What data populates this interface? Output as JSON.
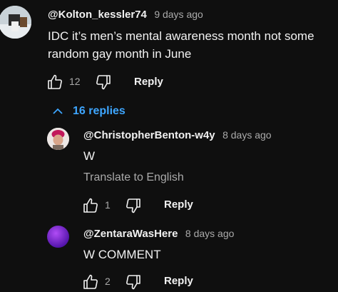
{
  "comment": {
    "author": "@Kolton_kessler74",
    "time": "9 days ago",
    "text_line1": "IDC it’s men’s mental awareness month not some",
    "text_line2": "random gay month in June",
    "likes": "12",
    "reply_label": "Reply"
  },
  "replies_toggle": {
    "label": "16 replies"
  },
  "replies": [
    {
      "author": "@ChristopherBenton-w4y",
      "time": "8 days ago",
      "text": "W",
      "translate_label": "Translate to English",
      "likes": "1",
      "reply_label": "Reply"
    },
    {
      "author": "@ZentaraWasHere",
      "time": "8 days ago",
      "text": "W COMMENT",
      "likes": "2",
      "reply_label": "Reply"
    }
  ],
  "colors": {
    "background": "#0f0f0f",
    "link": "#3ea6ff",
    "secondary_text": "#aaaaaa"
  }
}
